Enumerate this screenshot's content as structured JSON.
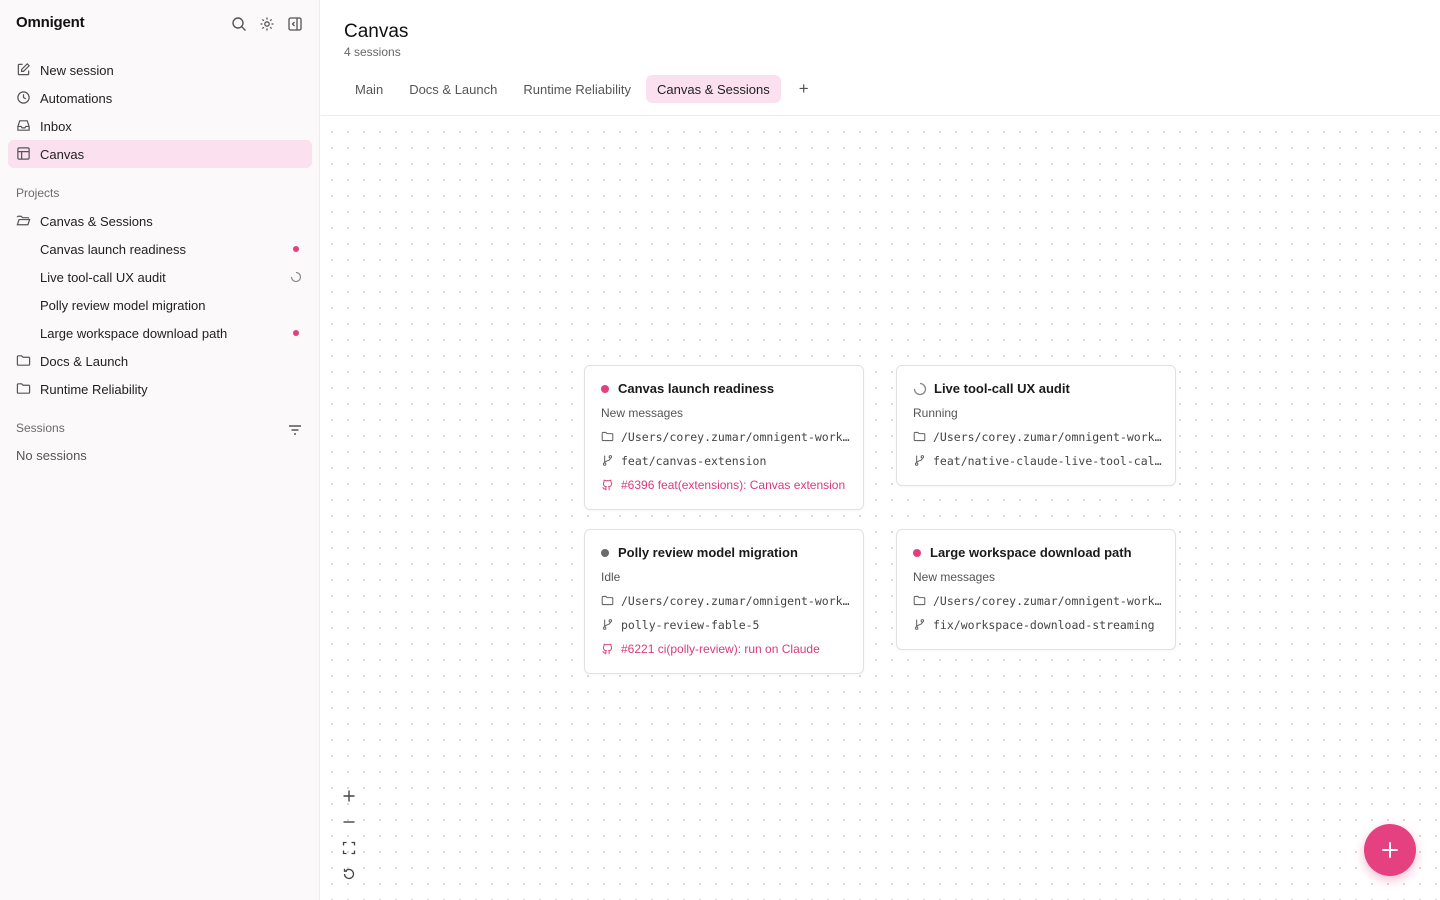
{
  "app": {
    "name": "Omnigent"
  },
  "sidebar": {
    "nav": [
      {
        "label": "New session",
        "icon": "edit-icon"
      },
      {
        "label": "Automations",
        "icon": "clock-icon"
      },
      {
        "label": "Inbox",
        "icon": "inbox-icon"
      },
      {
        "label": "Canvas",
        "icon": "canvas-icon",
        "active": true
      }
    ],
    "projects_label": "Projects",
    "projects": [
      {
        "label": "Canvas & Sessions",
        "open": true
      },
      {
        "label": "Canvas launch readiness",
        "status": "new-messages"
      },
      {
        "label": "Live tool-call UX audit",
        "status": "running"
      },
      {
        "label": "Polly review model migration",
        "status": "idle"
      },
      {
        "label": "Large workspace download path",
        "status": "new-messages"
      },
      {
        "label": "Docs & Launch"
      },
      {
        "label": "Runtime Reliability"
      }
    ],
    "sessions_label": "Sessions",
    "no_sessions": "No sessions"
  },
  "header": {
    "title": "Canvas",
    "subtitle": "4 sessions",
    "tabs": [
      {
        "label": "Main"
      },
      {
        "label": "Docs & Launch"
      },
      {
        "label": "Runtime Reliability"
      },
      {
        "label": "Canvas & Sessions",
        "active": true
      }
    ],
    "add_tab": "+"
  },
  "cards": [
    {
      "title": "Canvas launch readiness",
      "status": "New messages",
      "path": "/Users/corey.zumar/omnigent-workspace",
      "branch": "feat/canvas-extension",
      "pr": "#6396 feat(extensions): Canvas extension"
    },
    {
      "title": "Live tool-call UX audit",
      "status": "Running",
      "path": "/Users/corey.zumar/omnigent-workspace",
      "branch": "feat/native-claude-live-tool-calls"
    },
    {
      "title": "Polly review model migration",
      "status": "Idle",
      "path": "/Users/corey.zumar/omnigent-workspace",
      "branch": "polly-review-fable-5",
      "pr": "#6221 ci(polly-review): run on Claude"
    },
    {
      "title": "Large workspace download path",
      "status": "New messages",
      "path": "/Users/corey.zumar/omnigent-workspace",
      "branch": "fix/workspace-download-streaming"
    }
  ],
  "colors": {
    "accent": "#e5407f",
    "active_bg": "#fbe1ef",
    "new_messages_dot": "#e0417e",
    "idle_dot": "#6b6b6b"
  }
}
